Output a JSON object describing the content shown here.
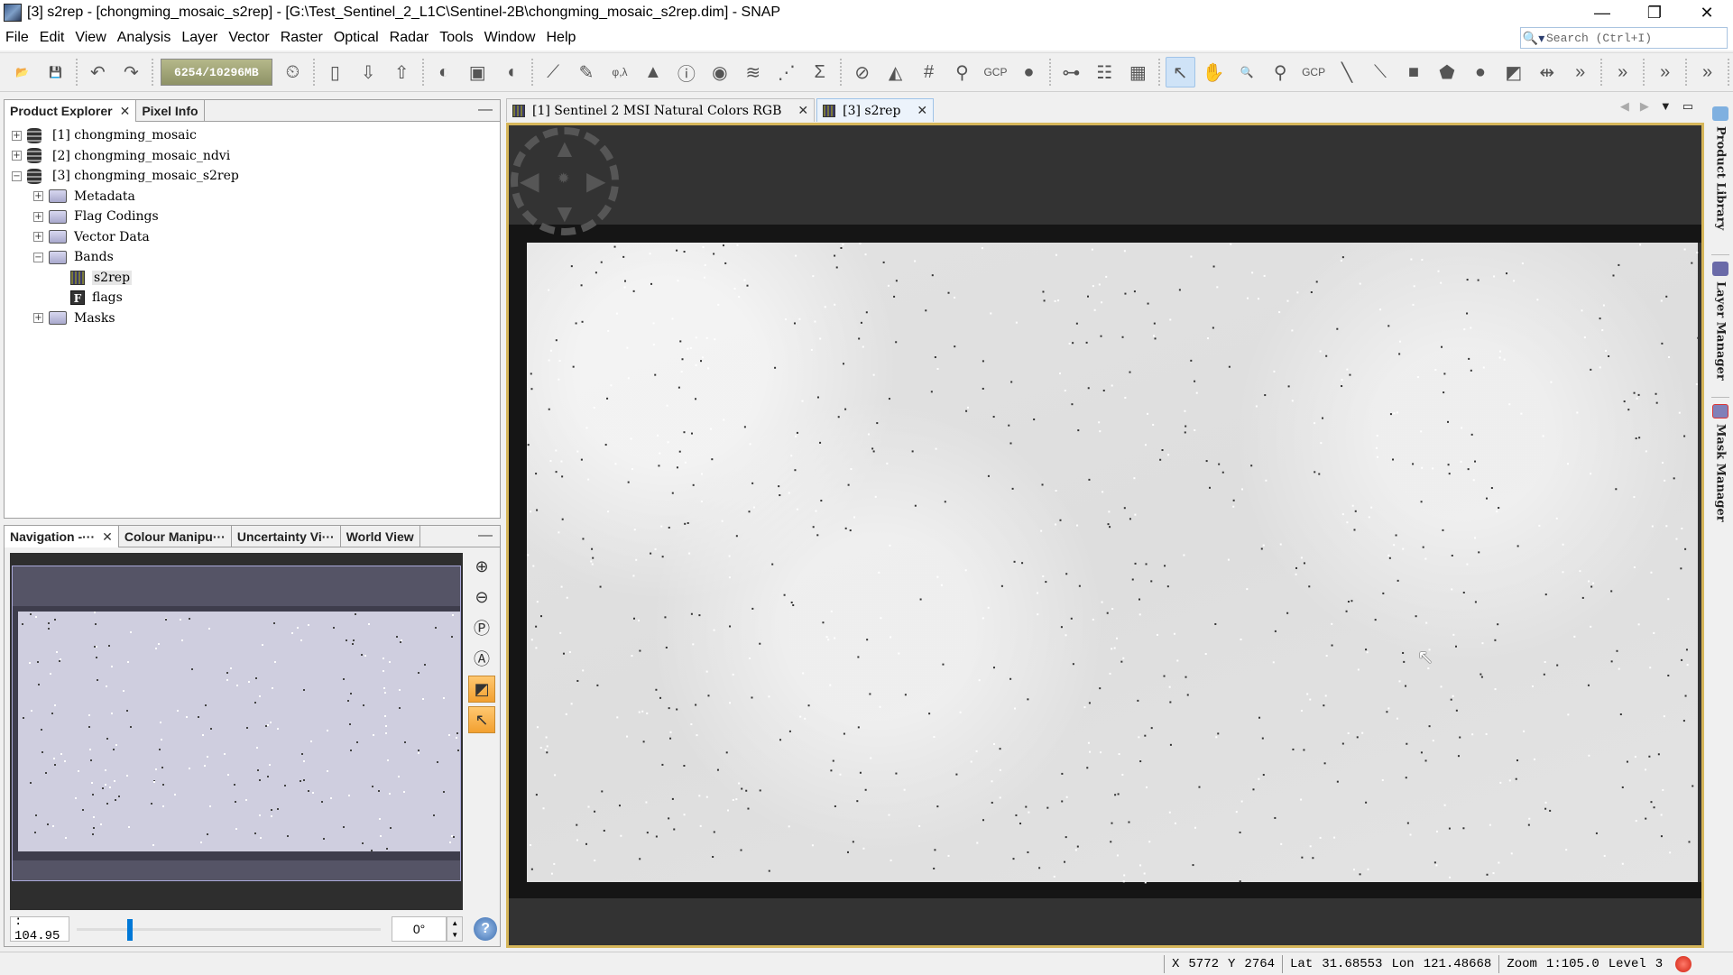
{
  "window": {
    "title": "[3] s2rep - [chongming_mosaic_s2rep] - [G:\\Test_Sentinel_2_L1C\\Sentinel-2B\\chongming_mosaic_s2rep.dim] - SNAP",
    "minimize": "—",
    "restore": "❐",
    "close": "✕"
  },
  "menu": [
    "File",
    "Edit",
    "View",
    "Analysis",
    "Layer",
    "Vector",
    "Raster",
    "Optical",
    "Radar",
    "Tools",
    "Window",
    "Help"
  ],
  "search": {
    "placeholder": "Search (Ctrl+I)",
    "icon": "search-icon"
  },
  "toolbar": {
    "memory": "6254/10296MB",
    "groups": [
      [
        {
          "name": "open-product",
          "glyph": "📂"
        },
        {
          "name": "save-product",
          "glyph": "💾"
        }
      ],
      [
        {
          "name": "undo",
          "glyph": "↶"
        },
        {
          "name": "redo",
          "glyph": "↷"
        }
      ],
      [
        {
          "name": "session",
          "glyph": "⏲"
        }
      ],
      [
        {
          "name": "product-library",
          "glyph": "▯"
        },
        {
          "name": "import",
          "glyph": "⇩"
        },
        {
          "name": "export",
          "glyph": "⇧"
        }
      ],
      [
        {
          "name": "rgb-image",
          "glyph": "◐"
        },
        {
          "name": "world-map",
          "glyph": "▣"
        },
        {
          "name": "wave",
          "glyph": "◖"
        }
      ],
      [
        {
          "name": "spectrum",
          "glyph": "⟋"
        },
        {
          "name": "pen",
          "glyph": "✎"
        },
        {
          "name": "geo-coding",
          "glyph": "φ,λ"
        },
        {
          "name": "histogram",
          "glyph": "▲"
        },
        {
          "name": "information",
          "glyph": "ⓘ"
        },
        {
          "name": "statistics",
          "glyph": "◉"
        },
        {
          "name": "profile-plot",
          "glyph": "≋"
        },
        {
          "name": "scatter-plot",
          "glyph": "⋰"
        },
        {
          "name": "band-maths",
          "glyph": "Σ"
        }
      ],
      [
        {
          "name": "overlay-none",
          "glyph": "⊘"
        },
        {
          "name": "overlay-image",
          "glyph": "◭"
        },
        {
          "name": "overlay-grid",
          "glyph": "#"
        },
        {
          "name": "overlay-pin",
          "glyph": "⚲"
        },
        {
          "name": "overlay-gcp",
          "glyph": "GCP"
        },
        {
          "name": "overlay-shape",
          "glyph": "●"
        }
      ],
      [
        {
          "name": "graph-builder",
          "glyph": "⊶"
        },
        {
          "name": "batch-processing",
          "glyph": "☷"
        },
        {
          "name": "world-wind",
          "glyph": "▦"
        }
      ],
      [
        {
          "name": "select-tool",
          "glyph": "↖",
          "active": true
        },
        {
          "name": "pan-tool",
          "glyph": "✋"
        },
        {
          "name": "zoom-tool",
          "glyph": "🔍"
        },
        {
          "name": "pin-placing-tool",
          "glyph": "⚲"
        },
        {
          "name": "gcp-placing-tool",
          "glyph": "GCP"
        },
        {
          "name": "line-drawing-tool",
          "glyph": "╲"
        },
        {
          "name": "polyline-drawing-tool",
          "glyph": "⟍"
        },
        {
          "name": "rectangle-drawing-tool",
          "glyph": "■"
        },
        {
          "name": "polygon-drawing-tool",
          "glyph": "⬟"
        },
        {
          "name": "ellipse-drawing-tool",
          "glyph": "●"
        },
        {
          "name": "magic-wand-tool",
          "glyph": "◩"
        },
        {
          "name": "range-finder-tool",
          "glyph": "⇹"
        },
        {
          "name": "more",
          "glyph": "»"
        }
      ],
      [
        {
          "name": "more-2",
          "glyph": "»"
        }
      ],
      [
        {
          "name": "more-3",
          "glyph": "»"
        }
      ],
      [
        {
          "name": "more-4",
          "glyph": "»"
        }
      ]
    ]
  },
  "product_explorer": {
    "tabs": [
      {
        "label": "Product Explorer",
        "closable": true,
        "active": true
      },
      {
        "label": "Pixel Info",
        "closable": false,
        "active": false
      }
    ],
    "tree": [
      {
        "level": 0,
        "expander": "+",
        "icon": "database",
        "label": "[1] chongming_mosaic"
      },
      {
        "level": 0,
        "expander": "+",
        "icon": "database",
        "label": "[2] chongming_mosaic_ndvi"
      },
      {
        "level": 0,
        "expander": "−",
        "icon": "database",
        "label": "[3] chongming_mosaic_s2rep"
      },
      {
        "level": 1,
        "expander": "+",
        "icon": "folder",
        "label": "Metadata"
      },
      {
        "level": 1,
        "expander": "+",
        "icon": "folder",
        "label": "Flag Codings"
      },
      {
        "level": 1,
        "expander": "+",
        "icon": "folder",
        "label": "Vector Data"
      },
      {
        "level": 1,
        "expander": "−",
        "icon": "folder-open",
        "label": "Bands"
      },
      {
        "level": 2,
        "expander": "",
        "icon": "band",
        "label": "s2rep",
        "selected": true
      },
      {
        "level": 2,
        "expander": "",
        "icon": "flag",
        "label": "flags"
      },
      {
        "level": 1,
        "expander": "+",
        "icon": "folder",
        "label": "Masks"
      }
    ]
  },
  "navigation_panel": {
    "tabs": [
      {
        "label": "Navigation -···",
        "closable": true,
        "active": true
      },
      {
        "label": "Colour Manipu···"
      },
      {
        "label": "Uncertainty Vi···"
      },
      {
        "label": "World View"
      }
    ],
    "zoom_value": ": 104.95",
    "zoom_slider_fraction": 0.17,
    "rotation": "0°",
    "buttons": [
      "zoom-in",
      "zoom-out",
      "zoom-pixel",
      "zoom-all",
      "sync-views",
      "sync-cursor"
    ]
  },
  "documents": {
    "tabs": [
      {
        "label": "[1] Sentinel 2 MSI Natural Colors RGB",
        "active": false
      },
      {
        "label": "[3] s2rep",
        "active": true
      }
    ]
  },
  "side_panels": [
    "Product Library",
    "Layer Manager",
    "Mask Manager"
  ],
  "status": {
    "x_label": "X",
    "x_value": "5772",
    "y_label": "Y",
    "y_value": "2764",
    "lat_label": "Lat",
    "lat_value": "31.68553",
    "lon_label": "Lon",
    "lon_value": "121.48668",
    "zoom_label": "Zoom",
    "zoom_value": "1:105.0",
    "level_label": "Level",
    "level_value": "3"
  }
}
